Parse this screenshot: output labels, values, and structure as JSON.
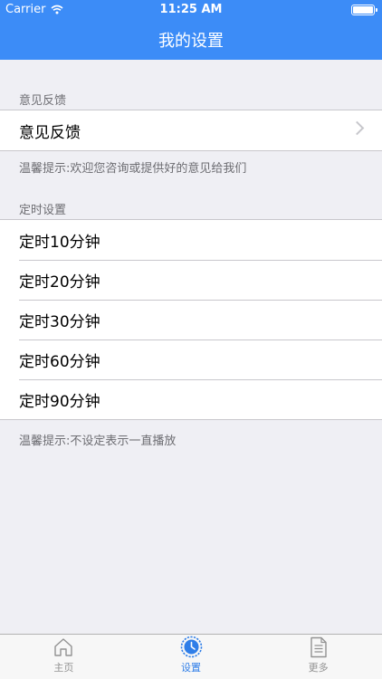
{
  "status": {
    "carrier": "Carrier",
    "time": "11:25 AM"
  },
  "nav": {
    "title": "我的设置"
  },
  "feedback": {
    "header": "意见反馈",
    "cell_label": "意见反馈",
    "footer": "温馨提示:欢迎您咨询或提供好的意见给我们"
  },
  "timer": {
    "header": "定时设置",
    "items": [
      "定时10分钟",
      "定时20分钟",
      "定时30分钟",
      "定时60分钟",
      "定时90分钟"
    ],
    "footer": "温馨提示:不设定表示一直播放"
  },
  "tabs": [
    {
      "label": "主页",
      "icon": "home-icon"
    },
    {
      "label": "设置",
      "icon": "settings-clock-icon"
    },
    {
      "label": "更多",
      "icon": "document-icon"
    }
  ],
  "colors": {
    "accent": "#3c8cf7",
    "tab_active": "#2f7ee8"
  }
}
